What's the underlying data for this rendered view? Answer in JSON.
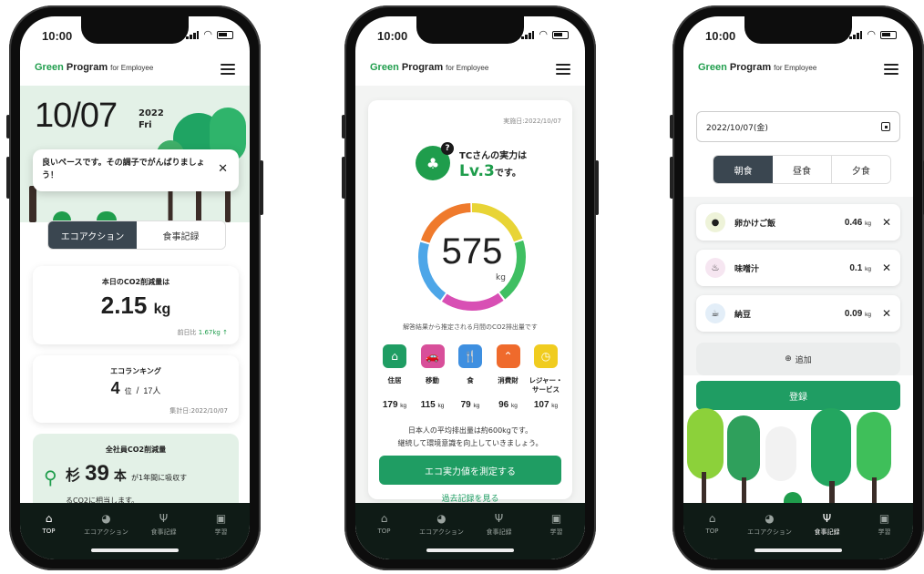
{
  "status": {
    "time": "10:00"
  },
  "app": {
    "brand_green": "Green",
    "brand_program": "Program",
    "brand_for": "for Employee"
  },
  "tabs": [
    {
      "label": "TOP",
      "icon": "home-icon"
    },
    {
      "label": "エコアクション",
      "icon": "pie-icon"
    },
    {
      "label": "食事記録",
      "icon": "cutlery-icon"
    },
    {
      "label": "学習",
      "icon": "book-icon"
    }
  ],
  "screen1": {
    "date": "10/07",
    "year": "2022",
    "weekday": "Fri",
    "toast": "良いペースです。その調子でがんばりましょう！",
    "toast_close": "✕",
    "segment": {
      "left": "エコアクション",
      "right": "食事記録"
    },
    "co2_card": {
      "title": "本日のCO2削減量は",
      "value": "2.15",
      "unit": "kg",
      "compare_label": "前日比",
      "compare_value": "1.67kg",
      "compare_arrow": "↑"
    },
    "rank_card": {
      "title": "エコランキング",
      "rank": "4",
      "rank_unit": "位",
      "sep": "/",
      "total": "17人",
      "footer": "集計日:2022/10/07"
    },
    "company_card": {
      "title": "全社員CO2削減量",
      "prefix": "杉",
      "value": "39",
      "unit": "本",
      "suffix": "が1年間に吸収す",
      "line2": "るCO2に相当します。"
    }
  },
  "screen2": {
    "date": "実施日:2022/10/07",
    "who": "TCさんの実力は",
    "level": "Lv.3",
    "level_suffix": "です。",
    "help": "?",
    "total": "575",
    "unit": "kg",
    "ring_colors": [
      "#e8d436",
      "#3fbf62",
      "#d84fb4",
      "#4da6e8",
      "#ef7a2c"
    ],
    "subtitle": "解答結果から推定される月間のCO2排出量です",
    "categories": [
      {
        "label": "住居",
        "value": "179",
        "unit": "kg",
        "color": "#1f9d63",
        "icon": "house-icon",
        "glyph": "⌂"
      },
      {
        "label": "移動",
        "value": "115",
        "unit": "kg",
        "color": "#d84f9a",
        "icon": "car-icon",
        "glyph": "🚗"
      },
      {
        "label": "食",
        "value": "79",
        "unit": "kg",
        "color": "#3e8fe0",
        "icon": "cutlery-icon",
        "glyph": "🍴"
      },
      {
        "label": "消費財",
        "value": "96",
        "unit": "kg",
        "color": "#ef6a2c",
        "icon": "hanger-icon",
        "glyph": "⌃"
      },
      {
        "label": "レジャー・\nサービス",
        "value": "107",
        "unit": "kg",
        "color": "#f0cc1f",
        "icon": "clock-icon",
        "glyph": "◷"
      }
    ],
    "note_line1": "日本人の平均排出量は約600kgです。",
    "note_line2": "継続して環境意識を向上していきましょう。",
    "measure_button": "エコ実力値を測定する",
    "history_link": "過去記録を見る"
  },
  "screen3": {
    "date_value": "2022/10/07(金)",
    "meal_tabs": [
      "朝食",
      "昼食",
      "夕食"
    ],
    "foods": [
      {
        "name": "卵かけご飯",
        "value": "0.46",
        "unit": "kg",
        "icon": "rice-bowl-icon",
        "glyph": "●",
        "bg": "#eef3d9"
      },
      {
        "name": "味噌汁",
        "value": "0.1",
        "unit": "kg",
        "icon": "soup-icon",
        "glyph": "♨",
        "bg": "#f6e6f1"
      },
      {
        "name": "納豆",
        "value": "0.09",
        "unit": "kg",
        "icon": "natto-icon",
        "glyph": "☕",
        "bg": "#e3eef8"
      }
    ],
    "remove": "✕",
    "add_label": "追加",
    "add_glyph": "⊕",
    "register_button": "登録"
  }
}
